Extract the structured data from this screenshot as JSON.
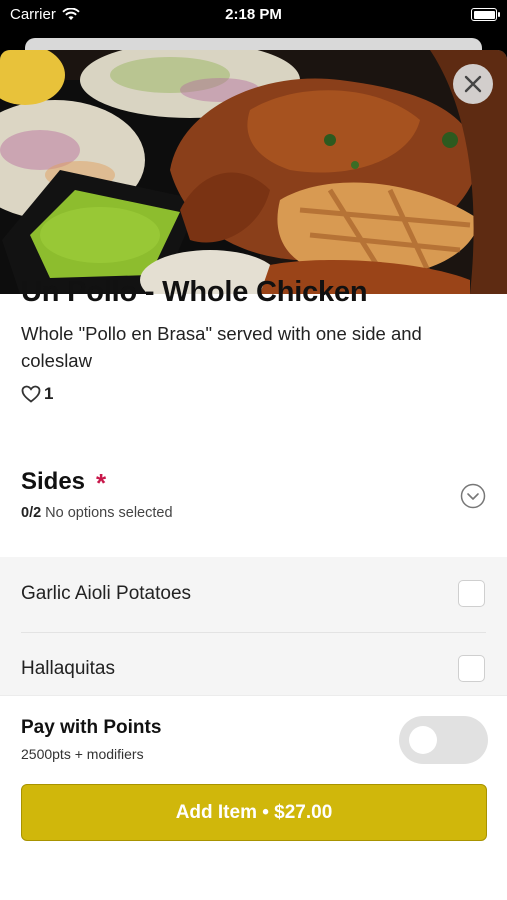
{
  "status_bar": {
    "carrier": "Carrier",
    "time": "2:18 PM"
  },
  "item": {
    "title": "Un Pollo - Whole Chicken",
    "description": "Whole \"Pollo en Brasa\" served with one side and coleslaw",
    "likes": "1"
  },
  "sides": {
    "title": "Sides",
    "required_marker": "*",
    "count": "0/2",
    "status": "No options selected",
    "options": [
      {
        "label": "Garlic Aioli Potatoes",
        "checked": false
      },
      {
        "label": "Hallaquitas",
        "checked": false
      }
    ]
  },
  "pay_with_points": {
    "title": "Pay with Points",
    "subtitle": "2500pts + modifiers",
    "enabled": false
  },
  "add_button": {
    "label": "Add Item • $27.00"
  },
  "colors": {
    "accent": "#d0b70b",
    "required": "#c8174a"
  }
}
